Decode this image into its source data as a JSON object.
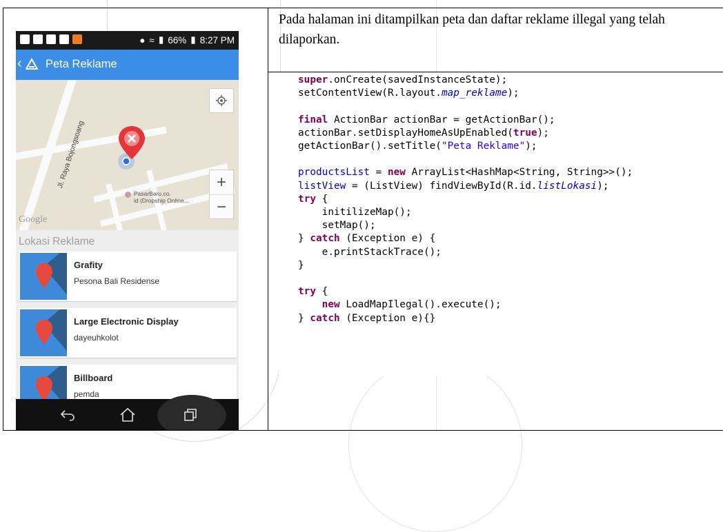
{
  "description": "Pada halaman ini ditampilkan peta dan daftar reklame illegal yang telah dilaporkan.",
  "phone": {
    "status": {
      "battery": "66%",
      "time": "8:27 PM"
    },
    "appbar_title": "Peta Reklame",
    "map": {
      "road_label": "Jl. Raya Bojongsoang",
      "poi_line1": "PasarBaru.co.",
      "poi_line2": "id (Dropship Online...",
      "google": "Google",
      "zoom_in": "+",
      "zoom_out": "−"
    },
    "list_header": "Lokasi Reklame",
    "items": [
      {
        "title": "Grafity",
        "subtitle": "Pesona Bali Residense"
      },
      {
        "title": "Large Electronic Display",
        "subtitle": "dayeuhkolot"
      },
      {
        "title": "Billboard",
        "subtitle": "pemda"
      }
    ]
  },
  "code": {
    "l1a": "super",
    "l1b": ".onCreate(savedInstanceState);",
    "l2a": "setContentView(R.layout.",
    "l2b": "map_reklame",
    "l2c": ");",
    "l4a": "final",
    "l4b": " ActionBar actionBar = getActionBar();",
    "l5a": "actionBar.setDisplayHomeAsUpEnabled(",
    "l5b": "true",
    "l5c": ");",
    "l6a": "getActionBar().setTitle(",
    "l6b": "\"Peta Reklame\"",
    "l6c": ");",
    "l8a": "productsList",
    "l8b": " = ",
    "l8c": "new",
    "l8d": " ArrayList<HashMap<String, String>>();",
    "l9a": "listView",
    "l9b": " = (ListView) findViewById(R.id.",
    "l9c": "listLokasi",
    "l9d": ");",
    "l10a": "try",
    "l10b": " {",
    "l11": "    initilizeMap();",
    "l12": "    setMap();",
    "l13a": "} ",
    "l13b": "catch",
    "l13c": " (Exception e) {",
    "l14": "    e.printStackTrace();",
    "l15": "}",
    "l17a": "try",
    "l17b": " {",
    "l18a": "    ",
    "l18b": "new",
    "l18c": " LoadMapIlegal().execute();",
    "l19a": "} ",
    "l19b": "catch",
    "l19c": " (Exception e){}"
  }
}
